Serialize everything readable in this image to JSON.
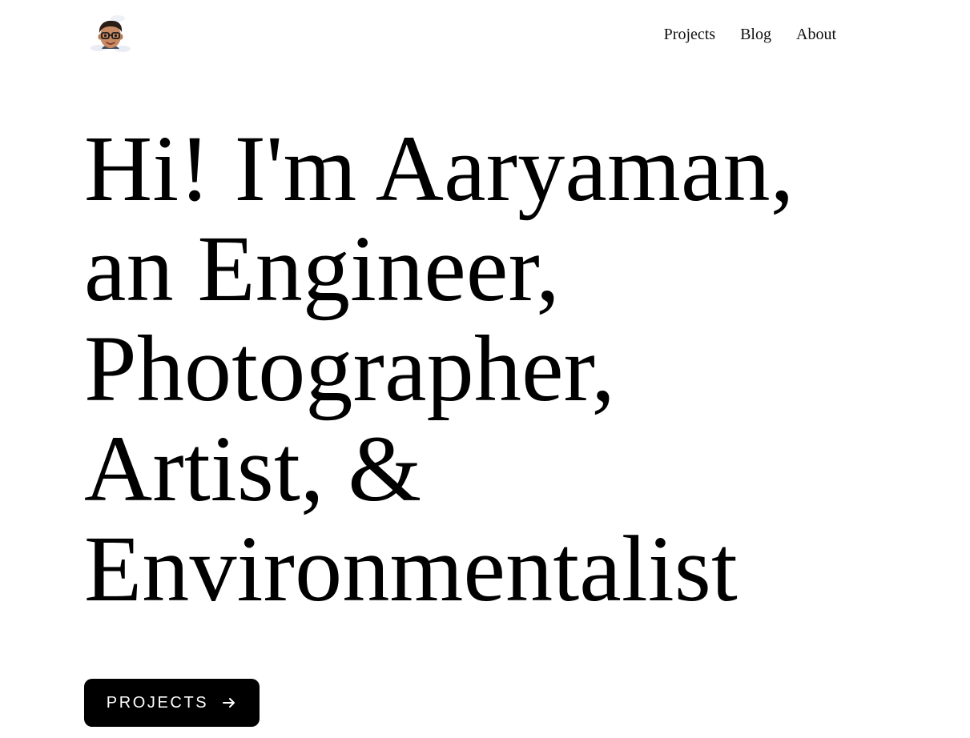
{
  "header": {
    "avatar_icon": "memoji-avatar-icon",
    "nav": [
      {
        "label": "Projects"
      },
      {
        "label": "Blog"
      },
      {
        "label": "About"
      }
    ]
  },
  "hero": {
    "lines": [
      "Hi! I'm Aaryaman,",
      "an Engineer,",
      "Photographer,",
      "Artist, &",
      "Environmentalist"
    ]
  },
  "cta": {
    "label": "PROJECTS",
    "icon": "arrow-right-icon"
  },
  "colors": {
    "background": "#ffffff",
    "text": "#000000",
    "button_bg": "#000000",
    "button_text": "#ffffff"
  }
}
